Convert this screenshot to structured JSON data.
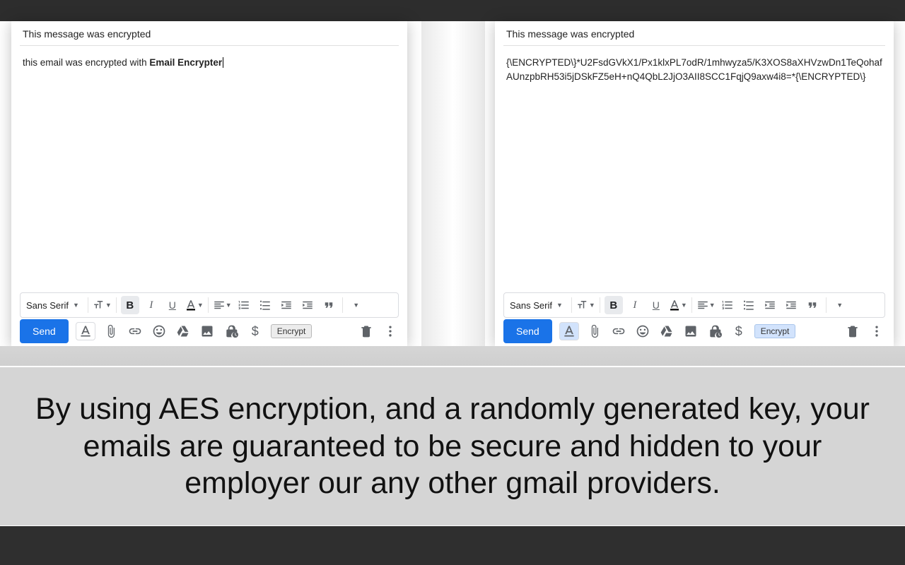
{
  "left": {
    "subject": "This message was encrypted",
    "body_prefix": "this email was encrypted with ",
    "body_bold": "Email Encrypter",
    "font": "Sans Serif",
    "send": "Send",
    "encrypt_label": "Encrypt",
    "a_highlight": false,
    "encrypt_highlight": false
  },
  "right": {
    "subject": "This message was encrypted",
    "body_plain": "{\\ENCRYPTED\\}*U2FsdGVkX1/Px1klxPL7odR/1mhwyza5/K3XOS8aXHVzwDn1TeQohafAUnzpbRH53i5jDSkFZ5eH+nQ4QbL2JjO3AII8SCC1FqjQ9axw4i8=*{\\ENCRYPTED\\}",
    "font": "Sans Serif",
    "send": "Send",
    "encrypt_label": "Encrypt",
    "a_highlight": true,
    "encrypt_highlight": true
  },
  "marketing_text": "By using AES encryption, and a randomly generated key, your emails are guaranteed to be secure and hidden to your employer our any other gmail providers.",
  "icons": {
    "bold": "B",
    "italic": "I",
    "underline": "U"
  }
}
